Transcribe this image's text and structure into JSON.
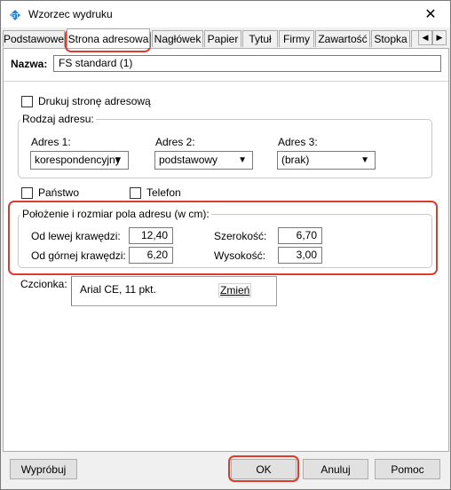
{
  "window": {
    "title": "Wzorzec wydruku",
    "close_glyph": "✕",
    "icon": "app-logo-icon"
  },
  "tabs": [
    {
      "label": "Podstawowe",
      "active": false
    },
    {
      "label": "Strona adresowa",
      "active": true
    },
    {
      "label": "Nagłówek",
      "active": false
    },
    {
      "label": "Papier",
      "active": false
    },
    {
      "label": "Tytuł",
      "active": false
    },
    {
      "label": "Firmy",
      "active": false
    },
    {
      "label": "Zawartość",
      "active": false
    },
    {
      "label": "Stopka",
      "active": false
    }
  ],
  "tab_scroll": {
    "left": "◀",
    "right": "▶"
  },
  "name_row": {
    "label": "Nazwa:",
    "value": "FS standard (1)"
  },
  "print_address_page": {
    "label": "Drukuj stronę adresową",
    "checked": false
  },
  "address_type": {
    "legend": "Rodzaj adresu:",
    "address1": {
      "label": "Adres 1:",
      "value": "korespondencyjny"
    },
    "address2": {
      "label": "Adres 2:",
      "value": "podstawowy"
    },
    "address3": {
      "label": "Adres 3:",
      "value": "(brak)"
    }
  },
  "country": {
    "label": "Państwo",
    "checked": false
  },
  "phone": {
    "label": "Telefon",
    "checked": false
  },
  "position": {
    "legend": "Położenie i rozmiar pola adresu (w cm):",
    "left_label": "Od lewej krawędzi:",
    "left_value": "12,40",
    "top_label": "Od górnej krawędzi:",
    "top_value": "6,20",
    "width_label": "Szerokość:",
    "width_value": "6,70",
    "height_label": "Wysokość:",
    "height_value": "3,00"
  },
  "font": {
    "label": "Czcionka:",
    "value": "Arial CE, 11 pkt.",
    "change_label": "Zmień"
  },
  "buttons": {
    "try": "Wypróbuj",
    "ok": "OK",
    "cancel": "Anuluj",
    "help": "Pomoc"
  },
  "colors": {
    "highlight": "#e03a2f",
    "window_bg": "#f0f0f0",
    "panel_bg": "#ffffff"
  }
}
